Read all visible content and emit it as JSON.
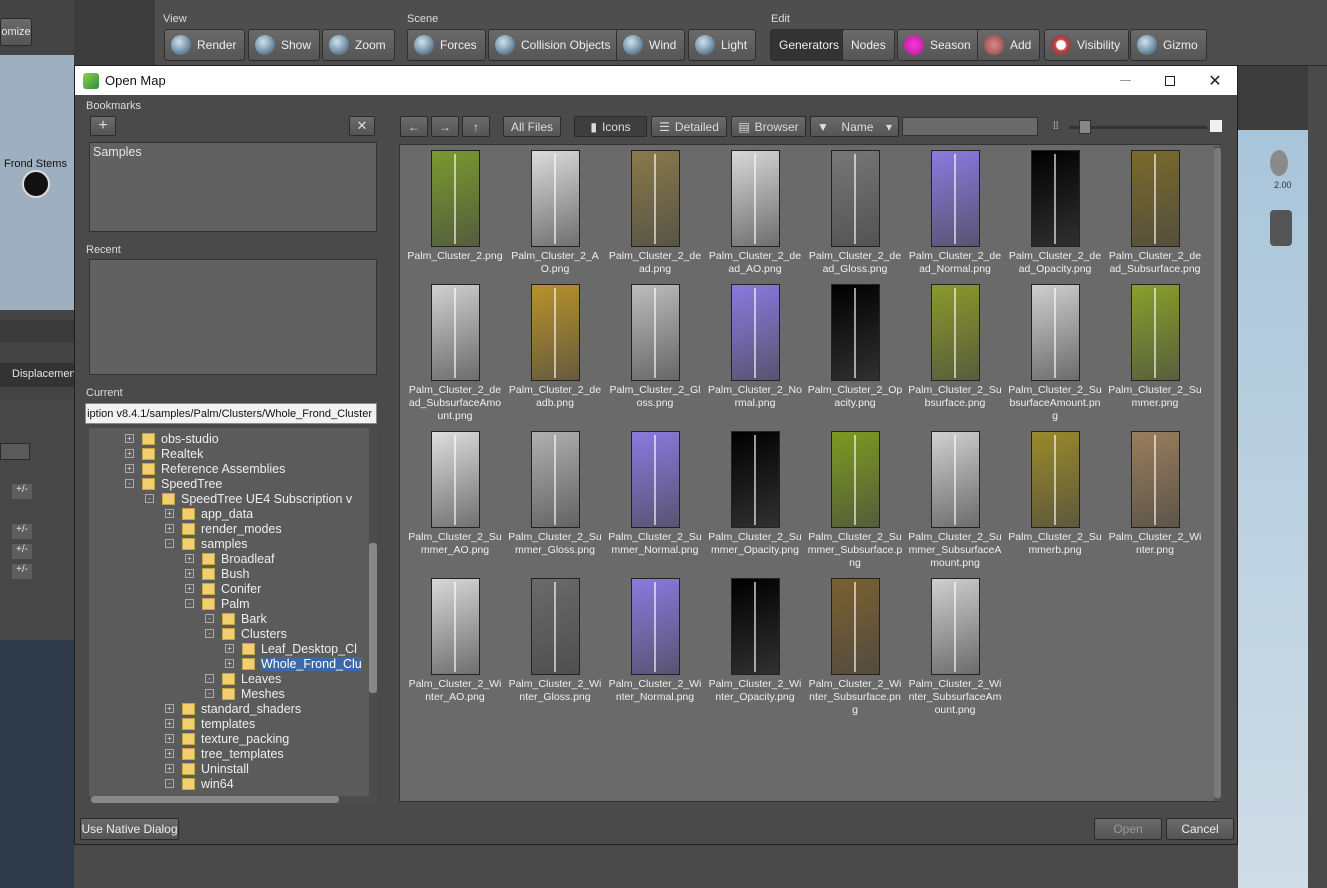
{
  "toolbar": {
    "view_label": "View",
    "scene_label": "Scene",
    "edit_label": "Edit",
    "buttons": {
      "render": "Render",
      "show": "Show",
      "zoom": "Zoom",
      "forces": "Forces",
      "collision": "Collision Objects",
      "wind": "Wind",
      "light": "Light",
      "generators": "Generators",
      "nodes": "Nodes",
      "season": "Season",
      "add": "Add",
      "visibility": "Visibility",
      "gizmo": "Gizmo"
    }
  },
  "background": {
    "minimize_label": "omize",
    "frond_stems": "Frond Stems",
    "displacement": "Displacemen",
    "plusminus": "+/-",
    "right_value": "2.00"
  },
  "dialog": {
    "title": "Open Map",
    "bookmarks_label": "Bookmarks",
    "bookmark_items": [
      "Samples"
    ],
    "recent_label": "Recent",
    "current_label": "Current",
    "current_path": "iption v8.4.1/samples/Palm/Clusters/Whole_Frond_Cluster",
    "nav": {
      "all_files": "All Files",
      "icons": "Icons",
      "detailed": "Detailed",
      "browser": "Browser",
      "sort": "Name"
    },
    "use_native": "Use Native Dialog",
    "open": "Open",
    "cancel": "Cancel"
  },
  "tree": [
    {
      "label": "obs-studio",
      "exp": "+"
    },
    {
      "label": "Realtek",
      "exp": "+"
    },
    {
      "label": "Reference Assemblies",
      "exp": "+"
    },
    {
      "label": "SpeedTree",
      "exp": "-"
    },
    {
      "label": "SpeedTree UE4 Subscription v",
      "exp": "-"
    },
    {
      "label": "app_data",
      "exp": "+"
    },
    {
      "label": "render_modes",
      "exp": "+"
    },
    {
      "label": "samples",
      "exp": "-"
    },
    {
      "label": "Broadleaf",
      "exp": "+"
    },
    {
      "label": "Bush",
      "exp": "+"
    },
    {
      "label": "Conifer",
      "exp": "+"
    },
    {
      "label": "Palm",
      "exp": "-"
    },
    {
      "label": "Bark",
      "exp": "-"
    },
    {
      "label": "Clusters",
      "exp": "-"
    },
    {
      "label": "Leaf_Desktop_Cl",
      "exp": "+"
    },
    {
      "label": "Whole_Frond_Clu",
      "exp": "+"
    },
    {
      "label": "Leaves",
      "exp": "-"
    },
    {
      "label": "Meshes",
      "exp": "-"
    },
    {
      "label": "standard_shaders",
      "exp": "+"
    },
    {
      "label": "templates",
      "exp": "+"
    },
    {
      "label": "texture_packing",
      "exp": "+"
    },
    {
      "label": "tree_templates",
      "exp": "+"
    },
    {
      "label": "Uninstall",
      "exp": "+"
    },
    {
      "label": "win64",
      "exp": "-"
    }
  ],
  "files": [
    {
      "name": "Palm_Cluster_2.png",
      "color": "#7a9a2e"
    },
    {
      "name": "Palm_Cluster_2_AO.png",
      "color": "#dcdcdc"
    },
    {
      "name": "Palm_Cluster_2_dead.png",
      "color": "#8a7a4a"
    },
    {
      "name": "Palm_Cluster_2_dead_AO.png",
      "color": "#d8d8d8"
    },
    {
      "name": "Palm_Cluster_2_dead_Gloss.png",
      "color": "#777777"
    },
    {
      "name": "Palm_Cluster_2_dead_Normal.png",
      "color": "#8a7ae0"
    },
    {
      "name": "Palm_Cluster_2_dead_Opacity.png",
      "color": "#000000"
    },
    {
      "name": "Palm_Cluster_2_dead_Subsurface.png",
      "color": "#7a6a2a"
    },
    {
      "name": "Palm_Cluster_2_dead_SubsurfaceAmount.png",
      "color": "#d0d0d0"
    },
    {
      "name": "Palm_Cluster_2_deadb.png",
      "color": "#b8922a"
    },
    {
      "name": "Palm_Cluster_2_Gloss.png",
      "color": "#bdbdbd"
    },
    {
      "name": "Palm_Cluster_2_Normal.png",
      "color": "#8a7ae0"
    },
    {
      "name": "Palm_Cluster_2_Opacity.png",
      "color": "#000000"
    },
    {
      "name": "Palm_Cluster_2_Subsurface.png",
      "color": "#8a9a2a"
    },
    {
      "name": "Palm_Cluster_2_SubsurfaceAmount.png",
      "color": "#cfcfcf"
    },
    {
      "name": "Palm_Cluster_2_Summer.png",
      "color": "#8aa02a"
    },
    {
      "name": "Palm_Cluster_2_Summer_AO.png",
      "color": "#dedede"
    },
    {
      "name": "Palm_Cluster_2_Summer_Gloss.png",
      "color": "#b0b0b0"
    },
    {
      "name": "Palm_Cluster_2_Summer_Normal.png",
      "color": "#8a7ae0"
    },
    {
      "name": "Palm_Cluster_2_Summer_Opacity.png",
      "color": "#000000"
    },
    {
      "name": "Palm_Cluster_2_Summer_Subsurface.png",
      "color": "#7d9a20"
    },
    {
      "name": "Palm_Cluster_2_Summer_SubsurfaceAmount.png",
      "color": "#d0d0d0"
    },
    {
      "name": "Palm_Cluster_2_Summerb.png",
      "color": "#9a8a2a"
    },
    {
      "name": "Palm_Cluster_2_Winter.png",
      "color": "#9a7e5a"
    },
    {
      "name": "Palm_Cluster_2_Winter_AO.png",
      "color": "#d8d8d8"
    },
    {
      "name": "Palm_Cluster_2_Winter_Gloss.png",
      "color": "#6a6a6a"
    },
    {
      "name": "Palm_Cluster_2_Winter_Normal.png",
      "color": "#8a7ae0"
    },
    {
      "name": "Palm_Cluster_2_Winter_Opacity.png",
      "color": "#000000"
    },
    {
      "name": "Palm_Cluster_2_Winter_Subsurface.png",
      "color": "#7a6030"
    },
    {
      "name": "Palm_Cluster_2_Winter_SubsurfaceAmount.png",
      "color": "#cfcfcf"
    }
  ]
}
